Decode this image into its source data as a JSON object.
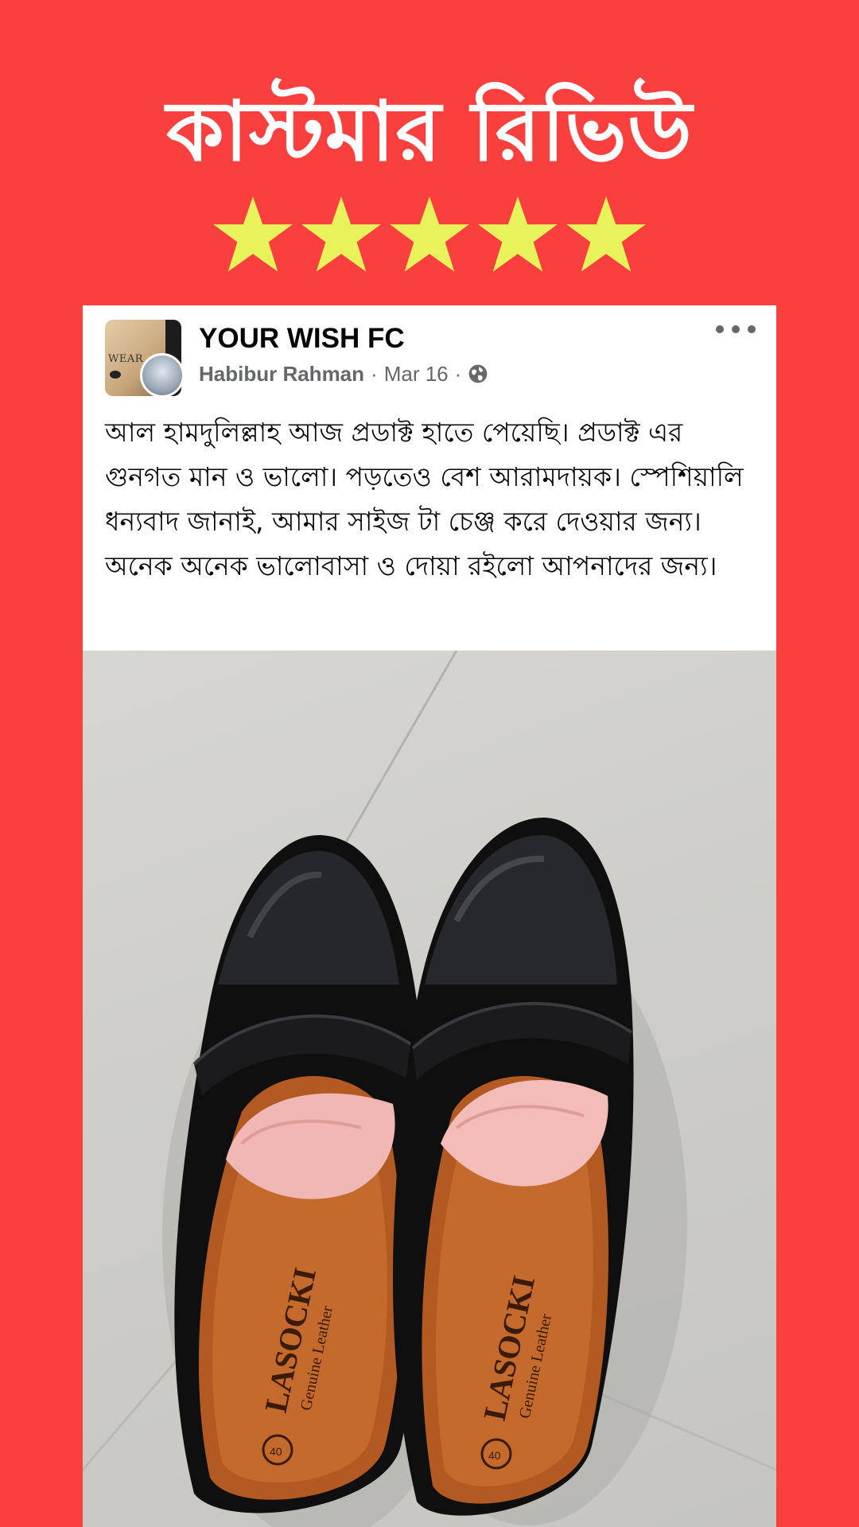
{
  "headline": "কাস্টমার রিভিউ",
  "rating": {
    "value": 5,
    "max": 5,
    "star_color": "#e8f25a"
  },
  "colors": {
    "background": "#f9403f",
    "card": "#ffffff"
  },
  "post": {
    "page_name": "YOUR WISH FC",
    "author": "Habibur Rahman",
    "separator": "·",
    "date": "Mar 16",
    "privacy_icon": "globe-icon",
    "menu_icon": "more-options-icon",
    "avatar_text": "WEAR",
    "body": "আল হামদুলিল্লাহ আজ প্রডাক্ট হাতে পেয়েছি। প্রডাক্ট এর গুনগত মান ও ভালো। পড়তেও বেশ আরামদায়ক। স্পেশিয়ালি ধন্যবাদ জানাই, আমার সাইজ টা চেঞ্জ করে দেওয়ার জন্য। অনেক অনেক ভালোবাসা ও দোয়া রইলো আপনাদের জন্য।"
  },
  "photo": {
    "brand": "LASOCKI",
    "subtext": "Genuine Leather",
    "size": "40"
  }
}
